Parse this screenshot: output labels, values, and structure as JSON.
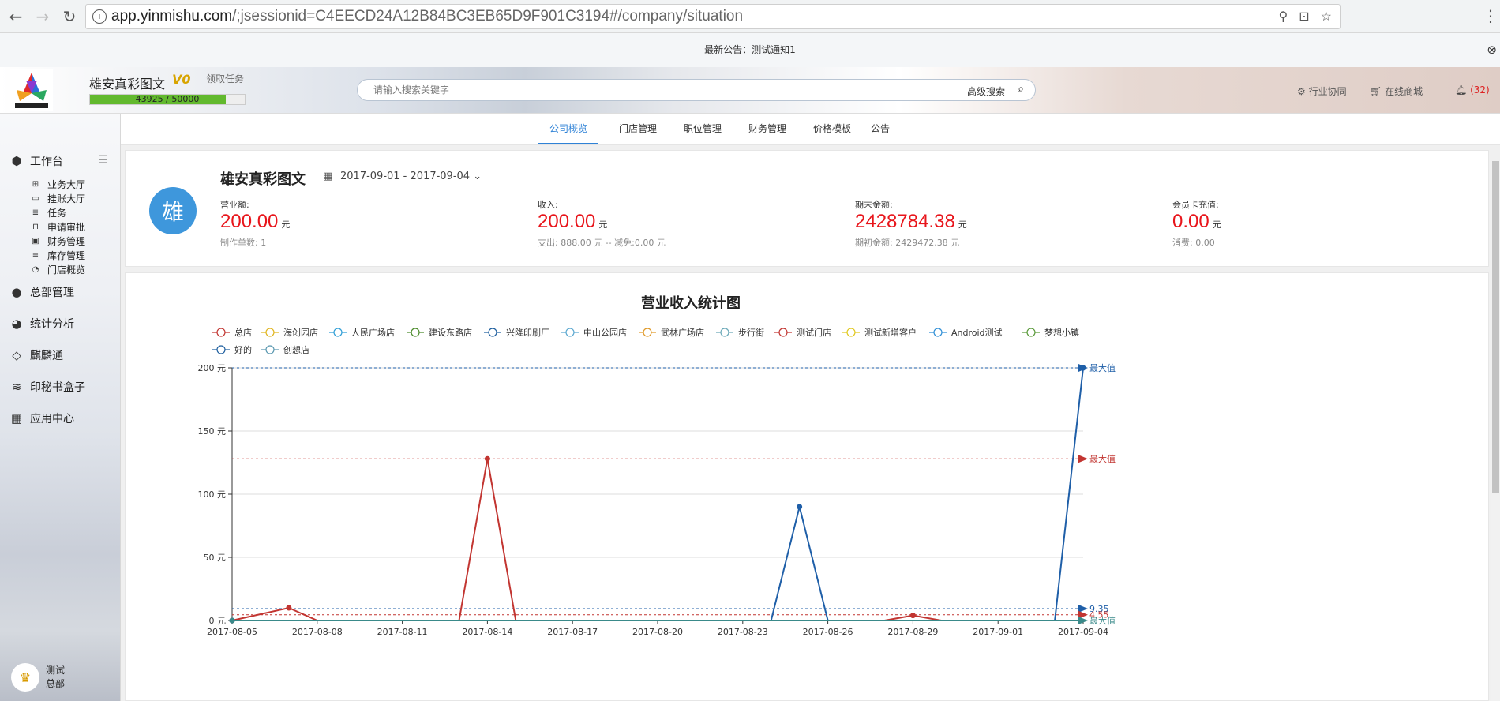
{
  "browser": {
    "url_host": "app.yinmishu.com",
    "url_path": "/;jsessionid=C4EECD24A12B84BC3EB65D9F901C3194#/company/situation"
  },
  "announcement": {
    "text": "最新公告：测试通知1"
  },
  "header": {
    "company": "雄安真彩图文",
    "vip_badge": "V0",
    "task_link": "领取任务",
    "progress_text": "43925 / 50000",
    "progress_value": 43925,
    "progress_max": 50000,
    "search_placeholder": "请输入搜索关键字",
    "advanced_search": "高级搜索",
    "industry_collab": "行业协同",
    "online_mall": "在线商城",
    "notification_count": "(32)"
  },
  "sidebar": {
    "workbench": "工作台",
    "sub_items": [
      "业务大厅",
      "挂账大厅",
      "任务",
      "申请审批",
      "财务管理",
      "库存管理",
      "门店概览"
    ],
    "main_items": [
      "总部管理",
      "统计分析",
      "麒麟通",
      "印秘书盒子",
      "应用中心"
    ],
    "user_name": "测试",
    "user_role": "总部"
  },
  "tabs": [
    "公司概览",
    "门店管理",
    "职位管理",
    "财务管理",
    "价格模板",
    "公告"
  ],
  "summary": {
    "company": "雄安真彩图文",
    "avatar_char": "雄",
    "date_range": "2017-09-01 - 2017-09-04",
    "stats": [
      {
        "label": "营业额:",
        "value": "200.00",
        "unit": "元",
        "sub": "制作单数: 1"
      },
      {
        "label": "收入:",
        "value": "200.00",
        "unit": "元",
        "sub": "支出: 888.00 元 -- 减免:0.00 元"
      },
      {
        "label": "期末金额:",
        "value": "2428784.38",
        "unit": "元",
        "sub": "期初金额: 2429472.38 元"
      },
      {
        "label": "会员卡充值:",
        "value": "0.00",
        "unit": "元",
        "sub": "消费: 0.00"
      }
    ]
  },
  "chart_data": {
    "type": "line",
    "title": "营业收入统计图",
    "x_ticks": [
      "2017-08-05",
      "2017-08-08",
      "2017-08-11",
      "2017-08-14",
      "2017-08-17",
      "2017-08-20",
      "2017-08-23",
      "2017-08-26",
      "2017-08-29",
      "2017-09-01",
      "2017-09-04"
    ],
    "y_ticks": [
      "0 元",
      "50 元",
      "100 元",
      "150 元",
      "200 元"
    ],
    "ylim": [
      0,
      200
    ],
    "x_start": "2017-08-05",
    "x_end": "2017-09-04",
    "legend": [
      "总店",
      "海创园店",
      "人民广场店",
      "建设东路店",
      "兴隆印刷厂",
      "中山公园店",
      "武林广场店",
      "步行街",
      "测试门店",
      "测试新增客户",
      "Android测试",
      "梦想小镇",
      "好的",
      "创想店"
    ],
    "legend_colors": [
      "#c23531",
      "#e0b51f",
      "#2f9ed6",
      "#4a8a2a",
      "#1f5f9f",
      "#5ba8d0",
      "#e09a2a",
      "#6aa8b8",
      "#c23531",
      "#e0c81f",
      "#2f8fd6",
      "#5a9a3a",
      "#1f5f9f",
      "#5a98b0"
    ],
    "series": [
      {
        "name": "测试门店",
        "color": "#c23531",
        "points": [
          [
            "2017-08-05",
            0
          ],
          [
            "2017-08-07",
            10
          ],
          [
            "2017-08-08",
            0
          ],
          [
            "2017-08-13",
            0
          ],
          [
            "2017-08-14",
            128
          ],
          [
            "2017-08-15",
            0
          ],
          [
            "2017-08-28",
            0
          ],
          [
            "2017-08-29",
            4
          ],
          [
            "2017-08-30",
            0
          ],
          [
            "2017-09-04",
            0
          ]
        ]
      },
      {
        "name": "Android测试",
        "color": "#1f5fa8",
        "points": [
          [
            "2017-08-05",
            0
          ],
          [
            "2017-08-24",
            0
          ],
          [
            "2017-08-25",
            90
          ],
          [
            "2017-08-26",
            0
          ],
          [
            "2017-09-03",
            0
          ],
          [
            "2017-09-04",
            200
          ]
        ]
      },
      {
        "name": "创想店",
        "color": "#3a8a8a",
        "points": [
          [
            "2017-08-05",
            0
          ],
          [
            "2017-09-04",
            0
          ]
        ]
      }
    ],
    "mark_lines": [
      {
        "label": "最大值",
        "value": 200,
        "color": "#1f5fa8"
      },
      {
        "label": "最大值",
        "value": 128,
        "color": "#c23531"
      },
      {
        "label": "9.35",
        "value": 9.35,
        "color": "#1f5fa8"
      },
      {
        "label": "4.55",
        "value": 4.55,
        "color": "#c23531"
      },
      {
        "label": "最大值",
        "value": 0,
        "color": "#3a8a8a"
      }
    ]
  }
}
